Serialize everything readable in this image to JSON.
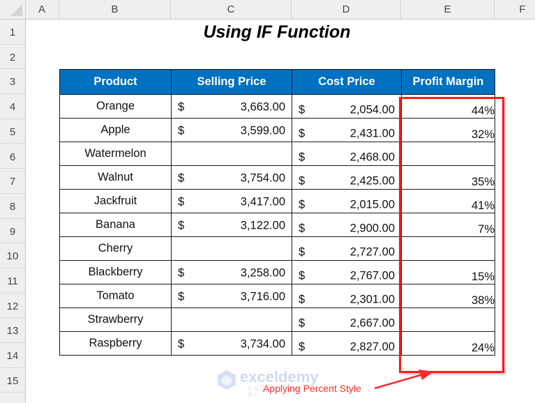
{
  "columns": [
    "A",
    "B",
    "C",
    "D",
    "E",
    "F"
  ],
  "rows": [
    "1",
    "2",
    "3",
    "4",
    "5",
    "6",
    "7",
    "8",
    "9",
    "10",
    "11",
    "12",
    "13",
    "14",
    "15"
  ],
  "title": "Using IF Function",
  "table": {
    "headers": [
      "Product",
      "Selling Price",
      "Cost Price",
      "Profit Margin"
    ],
    "currency_symbol": "$",
    "rows": [
      {
        "product": "Orange",
        "selling": "3,663.00",
        "cost": "2,054.00",
        "margin": "44%"
      },
      {
        "product": "Apple",
        "selling": "3,599.00",
        "cost": "2,431.00",
        "margin": "32%"
      },
      {
        "product": "Watermelon",
        "selling": "",
        "cost": "2,468.00",
        "margin": ""
      },
      {
        "product": "Walnut",
        "selling": "3,754.00",
        "cost": "2,425.00",
        "margin": "35%"
      },
      {
        "product": "Jackfruit",
        "selling": "3,417.00",
        "cost": "2,015.00",
        "margin": "41%"
      },
      {
        "product": "Banana",
        "selling": "3,122.00",
        "cost": "2,900.00",
        "margin": "7%"
      },
      {
        "product": "Cherry",
        "selling": "",
        "cost": "2,727.00",
        "margin": ""
      },
      {
        "product": "Blackberry",
        "selling": "3,258.00",
        "cost": "2,767.00",
        "margin": "15%"
      },
      {
        "product": "Tomato",
        "selling": "3,716.00",
        "cost": "2,301.00",
        "margin": "38%"
      },
      {
        "product": "Strawberry",
        "selling": "",
        "cost": "2,667.00",
        "margin": ""
      },
      {
        "product": "Raspberry",
        "selling": "3,734.00",
        "cost": "2,827.00",
        "margin": "24%"
      }
    ]
  },
  "annotation": "Applying Percent Style",
  "watermark": {
    "name": "exceldemy",
    "tagline": "EXCEL · DATA · BI"
  },
  "colors": {
    "header_bg": "#0070c0",
    "highlight": "#ff1a1a"
  }
}
